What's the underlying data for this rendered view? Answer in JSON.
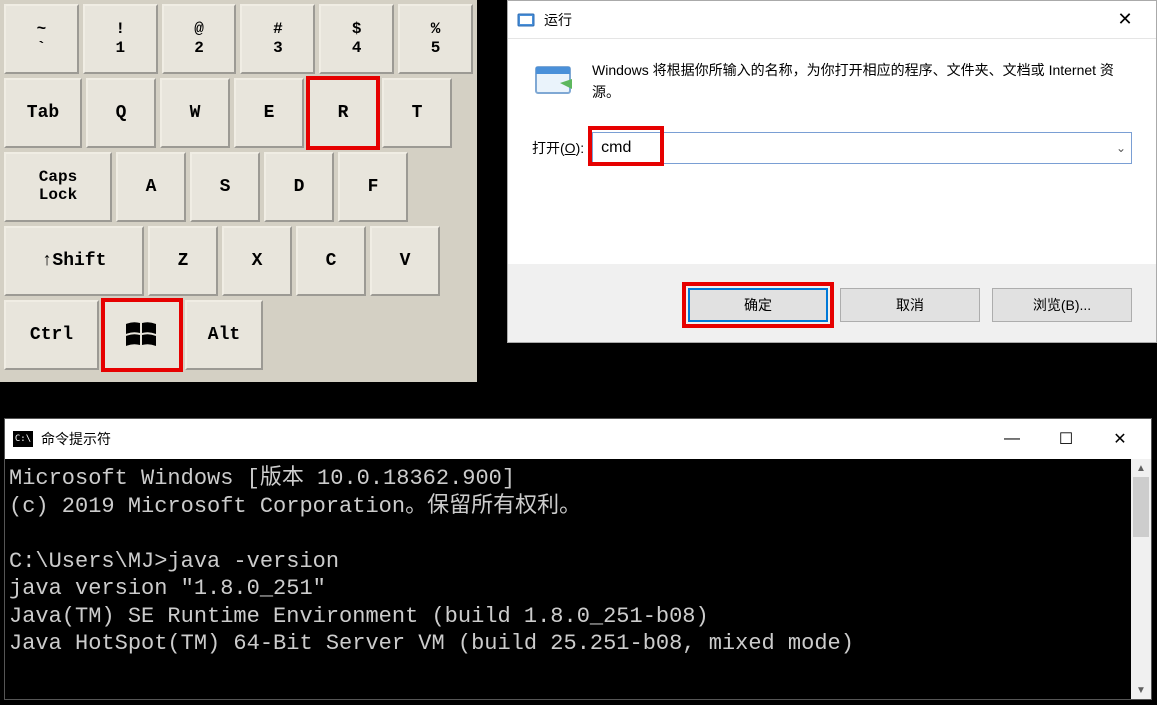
{
  "keyboard": {
    "row1": [
      {
        "upper": "~",
        "lower": "`"
      },
      {
        "upper": "!",
        "lower": "1"
      },
      {
        "upper": "@",
        "lower": "2"
      },
      {
        "upper": "#",
        "lower": "3"
      },
      {
        "upper": "$",
        "lower": "4"
      },
      {
        "upper": "%",
        "lower": "5"
      }
    ],
    "row2": {
      "tab": "Tab",
      "keys": [
        "Q",
        "W",
        "E",
        "R",
        "T"
      ]
    },
    "row3": {
      "caps": "Caps\nLock",
      "keys": [
        "A",
        "S",
        "D",
        "F"
      ]
    },
    "row4": {
      "shift": "↑Shift",
      "keys": [
        "Z",
        "X",
        "C",
        "V"
      ]
    },
    "row5": {
      "ctrl": "Ctrl",
      "alt": "Alt"
    }
  },
  "run_dialog": {
    "title": "运行",
    "description": "Windows 将根据你所输入的名称，为你打开相应的程序、文件夹、文档或 Internet 资源。",
    "open_label_prefix": "打开(",
    "open_label_underline": "O",
    "open_label_suffix": "):",
    "input_value": "cmd",
    "btn_ok": "确定",
    "btn_cancel": "取消",
    "btn_browse": "浏览(B)..."
  },
  "cmd": {
    "title": "命令提示符",
    "lines": [
      "Microsoft Windows [版本 10.0.18362.900]",
      "(c) 2019 Microsoft Corporation。保留所有权利。",
      "",
      "C:\\Users\\MJ>java -version",
      "java version \"1.8.0_251\"",
      "Java(TM) SE Runtime Environment (build 1.8.0_251-b08)",
      "Java HotSpot(TM) 64-Bit Server VM (build 25.251-b08, mixed mode)"
    ]
  }
}
